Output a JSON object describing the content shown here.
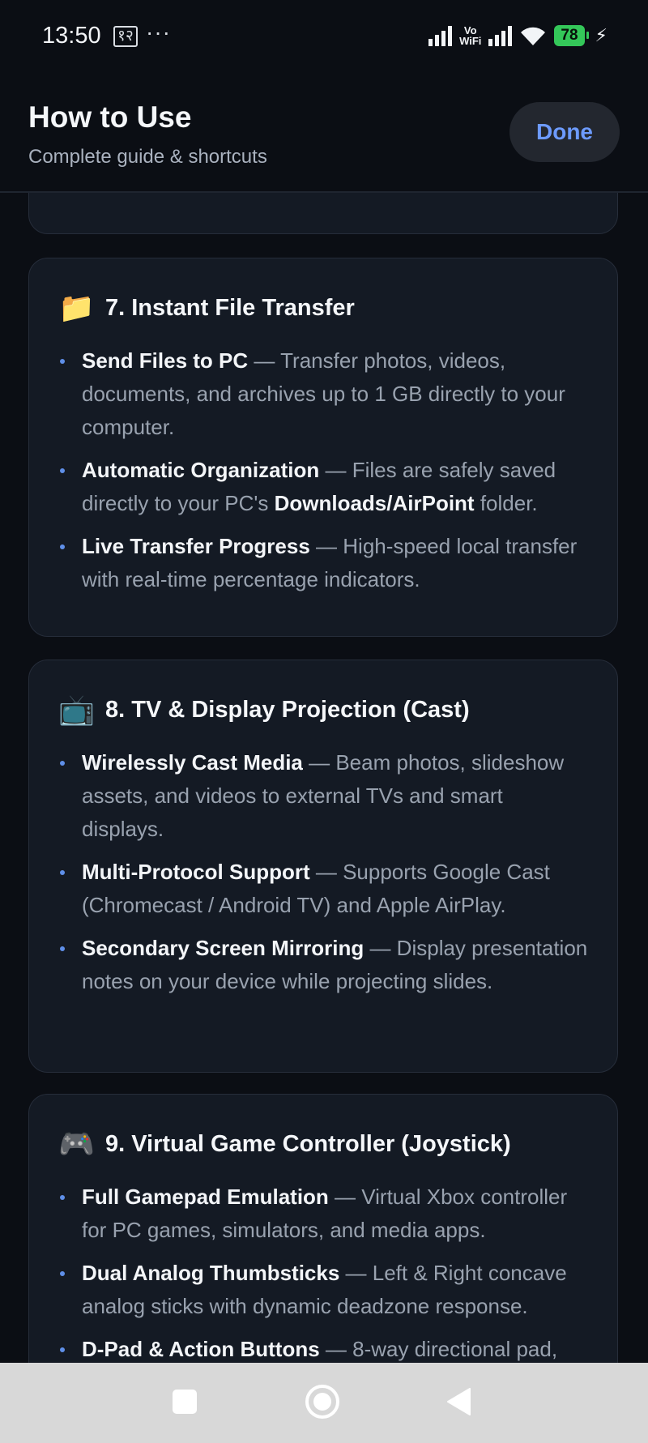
{
  "status_bar": {
    "time": "13:50",
    "badge": "१२",
    "dots": "···",
    "volte": "Vo WiFi",
    "battery": "78"
  },
  "header": {
    "title": "How to Use",
    "subtitle": "Complete guide & shortcuts",
    "done_label": "Done"
  },
  "sections": [
    {
      "emoji": "📁",
      "title": "7. Instant File Transfer",
      "items": [
        {
          "bold": "Send Files to PC",
          "text": " — Transfer photos, videos, documents, and archives up to 1 GB directly to your computer."
        },
        {
          "bold": "Automatic Organization",
          "text": " — Files are safely saved directly to your PC's ",
          "bold2": "Downloads/AirPoint",
          "text2": " folder."
        },
        {
          "bold": "Live Transfer Progress",
          "text": " — High-speed local transfer with real-time percentage indicators."
        }
      ]
    },
    {
      "emoji": "📺",
      "title": "8. TV & Display Projection (Cast)",
      "items": [
        {
          "bold": "Wirelessly Cast Media",
          "text": " — Beam photos, slideshow assets, and videos to external TVs and smart displays."
        },
        {
          "bold": "Multi-Protocol Support",
          "text": " — Supports Google Cast (Chromecast / Android TV) and Apple AirPlay."
        },
        {
          "bold": "Secondary Screen Mirroring",
          "text": " — Display presentation notes on your device while projecting slides."
        }
      ]
    },
    {
      "emoji": "🎮",
      "title": "9. Virtual Game Controller (Joystick)",
      "items": [
        {
          "bold": "Full Gamepad Emulation",
          "text": " — Virtual Xbox controller for PC games, simulators, and media apps."
        },
        {
          "bold": "Dual Analog Thumbsticks",
          "text": " — Left & Right concave analog sticks with dynamic deadzone response."
        },
        {
          "bold": "D-Pad & Action Buttons",
          "text": " — 8-way directional pad,"
        }
      ]
    }
  ]
}
